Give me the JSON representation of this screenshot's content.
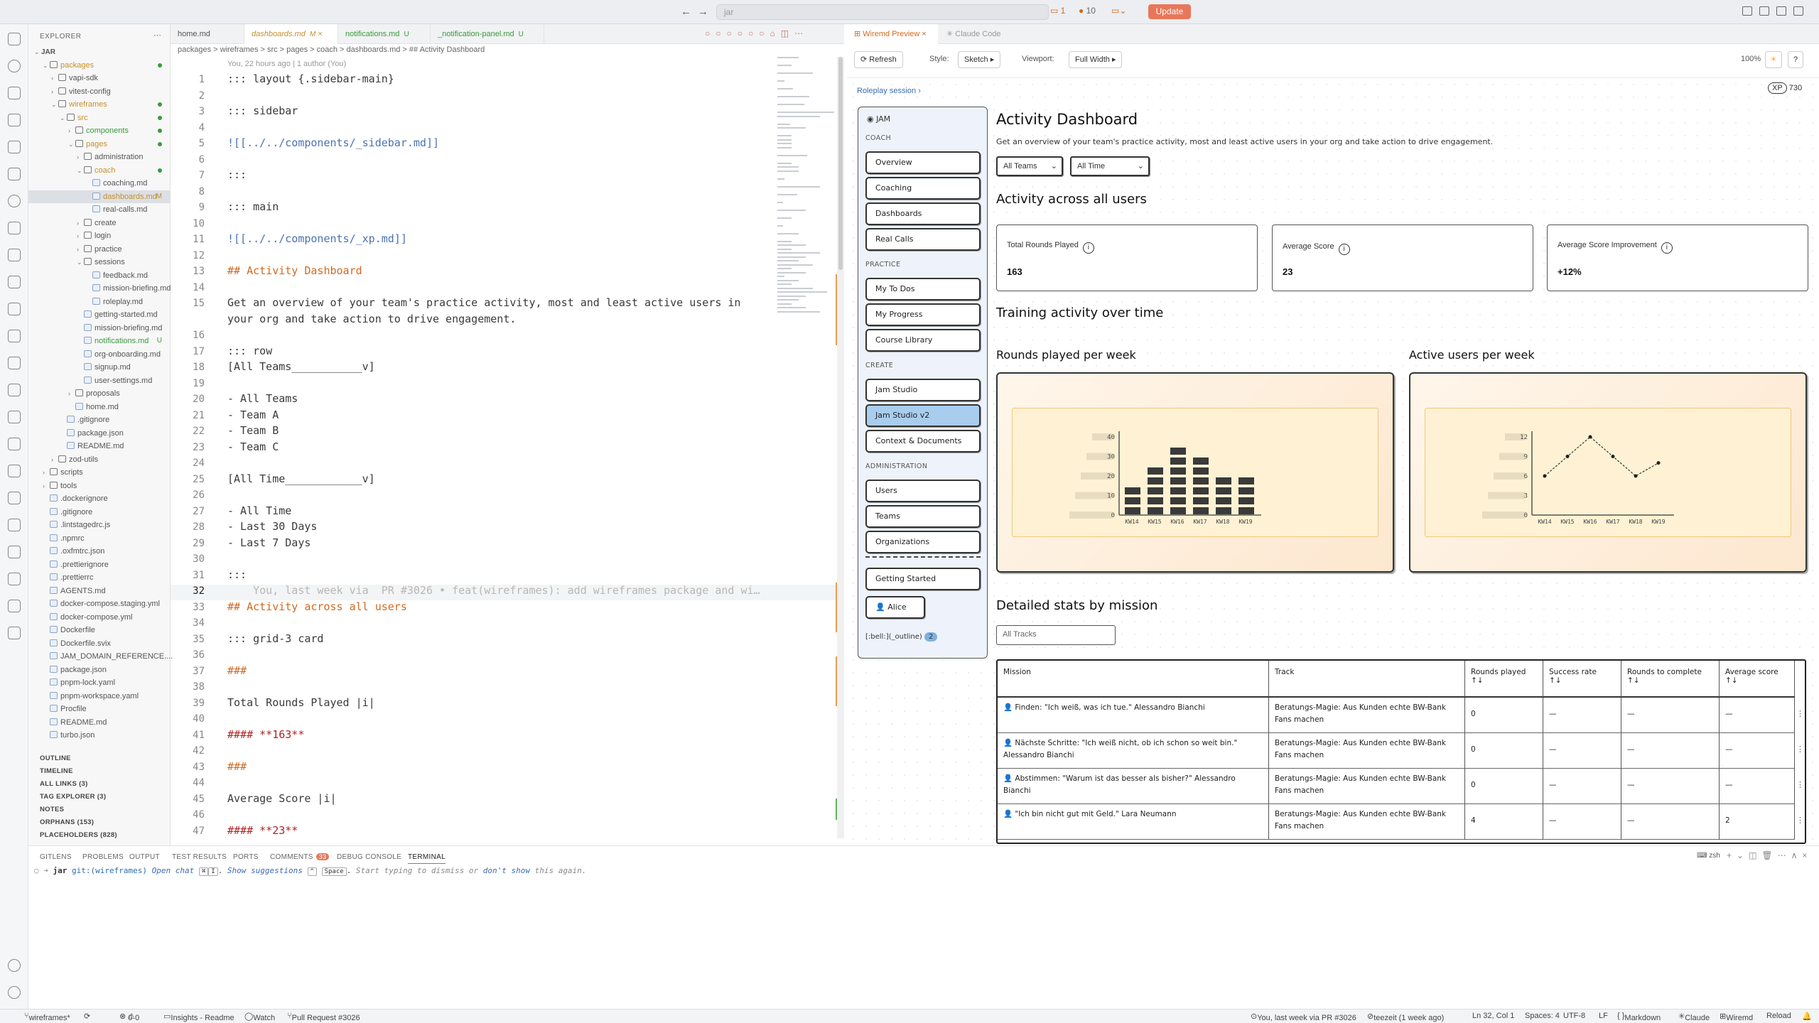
{
  "titlebar": {
    "search": "jar",
    "badge_comments": "1",
    "badge_errors": "10",
    "update": "Update"
  },
  "explorer": {
    "title": "EXPLORER",
    "rows": [
      {
        "t": "JAR",
        "d": 0,
        "f": "root",
        "c": "folder"
      },
      {
        "t": "packages",
        "d": 1,
        "f": "open",
        "c": "mod",
        "g": "dot"
      },
      {
        "t": "vapi-sdk",
        "d": 2,
        "f": "closed",
        "c": "folder"
      },
      {
        "t": "vitest-config",
        "d": 2,
        "f": "closed",
        "c": "folder"
      },
      {
        "t": "wireframes",
        "d": 2,
        "f": "open",
        "c": "mod",
        "g": "dot"
      },
      {
        "t": "src",
        "d": 3,
        "f": "open",
        "c": "mod",
        "g": "dot"
      },
      {
        "t": "components",
        "d": 4,
        "f": "closed",
        "c": "untr",
        "g": "dot"
      },
      {
        "t": "pages",
        "d": 4,
        "f": "open",
        "c": "mod",
        "g": "dot"
      },
      {
        "t": "administration",
        "d": 5,
        "f": "closed",
        "c": "folder"
      },
      {
        "t": "coach",
        "d": 5,
        "f": "open",
        "c": "mod",
        "g": "dot"
      },
      {
        "t": "coaching.md",
        "d": 6,
        "f": "file",
        "c": "folder"
      },
      {
        "t": "dashboards.md",
        "d": 6,
        "f": "file",
        "c": "mod",
        "g": "M",
        "sel": true
      },
      {
        "t": "real-calls.md",
        "d": 6,
        "f": "file",
        "c": "folder"
      },
      {
        "t": "create",
        "d": 5,
        "f": "closed",
        "c": "folder"
      },
      {
        "t": "login",
        "d": 5,
        "f": "closed",
        "c": "folder"
      },
      {
        "t": "practice",
        "d": 5,
        "f": "closed",
        "c": "folder"
      },
      {
        "t": "sessions",
        "d": 5,
        "f": "open",
        "c": "folder"
      },
      {
        "t": "feedback.md",
        "d": 6,
        "f": "file",
        "c": "folder"
      },
      {
        "t": "mission-briefing.md",
        "d": 6,
        "f": "file",
        "c": "folder"
      },
      {
        "t": "roleplay.md",
        "d": 6,
        "f": "file",
        "c": "folder"
      },
      {
        "t": "getting-started.md",
        "d": 5,
        "f": "file",
        "c": "folder"
      },
      {
        "t": "mission-briefing.md",
        "d": 5,
        "f": "file",
        "c": "folder"
      },
      {
        "t": "notifications.md",
        "d": 5,
        "f": "file",
        "c": "untr",
        "g": "U"
      },
      {
        "t": "org-onboarding.md",
        "d": 5,
        "f": "file",
        "c": "folder"
      },
      {
        "t": "signup.md",
        "d": 5,
        "f": "file",
        "c": "folder"
      },
      {
        "t": "user-settings.md",
        "d": 5,
        "f": "file",
        "c": "folder"
      },
      {
        "t": "proposals",
        "d": 4,
        "f": "closed",
        "c": "folder"
      },
      {
        "t": "home.md",
        "d": 4,
        "f": "file",
        "c": "folder"
      },
      {
        "t": ".gitignore",
        "d": 3,
        "f": "file",
        "c": "folder"
      },
      {
        "t": "package.json",
        "d": 3,
        "f": "file",
        "c": "folder"
      },
      {
        "t": "README.md",
        "d": 3,
        "f": "file",
        "c": "folder"
      },
      {
        "t": "zod-utils",
        "d": 2,
        "f": "closed",
        "c": "folder"
      },
      {
        "t": "scripts",
        "d": 1,
        "f": "closed",
        "c": "folder"
      },
      {
        "t": "tools",
        "d": 1,
        "f": "closed",
        "c": "folder"
      },
      {
        "t": ".dockerignore",
        "d": 1,
        "f": "file",
        "c": "folder"
      },
      {
        "t": ".gitignore",
        "d": 1,
        "f": "file",
        "c": "folder"
      },
      {
        "t": ".lintstagedrc.js",
        "d": 1,
        "f": "file",
        "c": "folder"
      },
      {
        "t": ".npmrc",
        "d": 1,
        "f": "file",
        "c": "folder"
      },
      {
        "t": ".oxfmtrc.json",
        "d": 1,
        "f": "file",
        "c": "folder"
      },
      {
        "t": ".prettierignore",
        "d": 1,
        "f": "file",
        "c": "folder"
      },
      {
        "t": ".prettierrc",
        "d": 1,
        "f": "file",
        "c": "folder"
      },
      {
        "t": "AGENTS.md",
        "d": 1,
        "f": "file",
        "c": "folder"
      },
      {
        "t": "docker-compose.staging.yml",
        "d": 1,
        "f": "file",
        "c": "folder"
      },
      {
        "t": "docker-compose.yml",
        "d": 1,
        "f": "file",
        "c": "folder"
      },
      {
        "t": "Dockerfile",
        "d": 1,
        "f": "file",
        "c": "folder"
      },
      {
        "t": "Dockerfile.svix",
        "d": 1,
        "f": "file",
        "c": "folder"
      },
      {
        "t": "JAM_DOMAIN_REFERENCE....",
        "d": 1,
        "f": "file",
        "c": "folder"
      },
      {
        "t": "package.json",
        "d": 1,
        "f": "file",
        "c": "folder"
      },
      {
        "t": "pnpm-lock.yaml",
        "d": 1,
        "f": "file",
        "c": "folder"
      },
      {
        "t": "pnpm-workspace.yaml",
        "d": 1,
        "f": "file",
        "c": "folder"
      },
      {
        "t": "Procfile",
        "d": 1,
        "f": "file",
        "c": "folder"
      },
      {
        "t": "README.md",
        "d": 1,
        "f": "file",
        "c": "folder"
      },
      {
        "t": "turbo.json",
        "d": 1,
        "f": "file",
        "c": "folder"
      }
    ],
    "sections": [
      "OUTLINE",
      "TIMELINE",
      "ALL LINKS (3)",
      "TAG EXPLORER (3)",
      "NOTES",
      "ORPHANS (153)",
      "PLACEHOLDERS (828)"
    ]
  },
  "editor": {
    "tabs": [
      {
        "label": "home.md",
        "status": ""
      },
      {
        "label": "dashboards.md",
        "status": "M"
      },
      {
        "label": "notifications.md",
        "status": "U"
      },
      {
        "label": "_notification-panel.md",
        "status": "U"
      }
    ],
    "breadcrumb": "packages > wireframes > src > pages > coach > dashboards.md > ## Activity Dashboard",
    "blame": "You, 22 hours ago | 1 author (You)",
    "lines": [
      {
        "n": "1",
        "t": "::: layout {.sidebar-main}"
      },
      {
        "n": "2",
        "t": ""
      },
      {
        "n": "3",
        "t": "::: sidebar"
      },
      {
        "n": "4",
        "t": ""
      },
      {
        "n": "5",
        "t": "![[../../components/_sidebar.md]]",
        "k": "lk"
      },
      {
        "n": "6",
        "t": ""
      },
      {
        "n": "7",
        "t": ":::"
      },
      {
        "n": "8",
        "t": ""
      },
      {
        "n": "9",
        "t": "::: main"
      },
      {
        "n": "10",
        "t": ""
      },
      {
        "n": "11",
        "t": "![[../../components/_xp.md]]",
        "k": "lk"
      },
      {
        "n": "12",
        "t": ""
      },
      {
        "n": "13",
        "t": "## Activity Dashboard",
        "k": "h"
      },
      {
        "n": "14",
        "t": ""
      },
      {
        "n": "15",
        "t": "Get an overview of your team's practice activity, most and least active users in"
      },
      {
        "n": "",
        "t": "your org and take action to drive engagement."
      },
      {
        "n": "16",
        "t": ""
      },
      {
        "n": "17",
        "t": "::: row"
      },
      {
        "n": "18",
        "t": "[All Teams___________v]"
      },
      {
        "n": "19",
        "t": ""
      },
      {
        "n": "20",
        "t": "- All Teams"
      },
      {
        "n": "21",
        "t": "- Team A"
      },
      {
        "n": "22",
        "t": "- Team B"
      },
      {
        "n": "23",
        "t": "- Team C"
      },
      {
        "n": "24",
        "t": ""
      },
      {
        "n": "25",
        "t": "[All Time____________v]"
      },
      {
        "n": "26",
        "t": ""
      },
      {
        "n": "27",
        "t": "- All Time"
      },
      {
        "n": "28",
        "t": "- Last 30 Days"
      },
      {
        "n": "29",
        "t": "- Last 7 Days"
      },
      {
        "n": "30",
        "t": ""
      },
      {
        "n": "31",
        "t": ":::"
      },
      {
        "n": "32",
        "t": "    You, last week via  PR #3026 • feat(wireframes): add wireframes package and wi…",
        "k": "ghost"
      },
      {
        "n": "33",
        "t": "## Activity across all users",
        "k": "h"
      },
      {
        "n": "34",
        "t": ""
      },
      {
        "n": "35",
        "t": "::: grid-3 card"
      },
      {
        "n": "36",
        "t": ""
      },
      {
        "n": "37",
        "t": "###",
        "k": "h"
      },
      {
        "n": "38",
        "t": ""
      },
      {
        "n": "39",
        "t": "Total Rounds Played |i|"
      },
      {
        "n": "40",
        "t": ""
      },
      {
        "n": "41",
        "t": "#### **163**",
        "k": "hb"
      },
      {
        "n": "42",
        "t": ""
      },
      {
        "n": "43",
        "t": "###",
        "k": "h"
      },
      {
        "n": "44",
        "t": ""
      },
      {
        "n": "45",
        "t": "Average Score |i|"
      },
      {
        "n": "46",
        "t": ""
      },
      {
        "n": "47",
        "t": "#### **23**",
        "k": "hb"
      }
    ]
  },
  "preview": {
    "tabs": [
      "Wiremd Preview",
      "Claude Code"
    ],
    "refresh": "Refresh",
    "style_label": "Style:",
    "style_value": "Sketch",
    "viewport_label": "Viewport:",
    "viewport_value": "Full Width",
    "zoom": "100%",
    "help": "?",
    "roleplay_link": "Roleplay session ›",
    "xp_label": "XP",
    "xp_value": "730",
    "sidebar": {
      "brand": "JAM",
      "sections": [
        {
          "title": "COACH",
          "items": [
            "Overview",
            "Coaching",
            "Dashboards",
            "Real Calls"
          ]
        },
        {
          "title": "PRACTICE",
          "items": [
            "My To Dos",
            "My Progress",
            "Course Library"
          ]
        },
        {
          "title": "CREATE",
          "items": [
            "Jam Studio",
            "Jam Studio v2",
            "Context & Documents"
          ]
        },
        {
          "title": "ADMINISTRATION",
          "items": [
            "Users",
            "Teams",
            "Organizations"
          ]
        }
      ],
      "active": "Jam Studio v2",
      "getting_started": "Getting Started",
      "user": "Alice",
      "bell_text": "[:bell:](_outline)",
      "bell_count": "2"
    },
    "main": {
      "title": "Activity Dashboard",
      "desc": "Get an overview of your team's practice activity, most and least active users in your org and take action to drive engagement.",
      "team_select": "All Teams",
      "time_select": "All Time",
      "section1": "Activity across all users",
      "cards": [
        {
          "label": "Total Rounds Played",
          "value": "163"
        },
        {
          "label": "Average Score",
          "value": "23"
        },
        {
          "label": "Average Score Improvement",
          "value": "+12%"
        }
      ],
      "section2": "Training activity over time",
      "chart1_title": "Rounds played per week",
      "chart2_title": "Active users per week",
      "section3": "Detailed stats by mission",
      "filter": "All Tracks",
      "table": {
        "headers": [
          "Mission",
          "Track",
          "Rounds played\n↑↓",
          "Success rate\n↑↓",
          "Rounds to complete\n↑↓",
          "Average score\n↑↓"
        ],
        "rows": [
          [
            "👤 Finden: \"Ich weiß, was ich tue.\" Alessandro Bianchi",
            "Beratungs-Magie: Aus Kunden echte BW-Bank Fans machen",
            "0",
            "—",
            "—",
            "—"
          ],
          [
            "👤 Nächste Schritte: \"Ich weiß nicht, ob ich schon so weit bin.\" Alessandro Bianchi",
            "Beratungs-Magie: Aus Kunden echte BW-Bank Fans machen",
            "0",
            "—",
            "—",
            "—"
          ],
          [
            "👤 Abstimmen: \"Warum ist das besser als bisher?\" Alessandro Bianchi",
            "Beratungs-Magie: Aus Kunden echte BW-Bank Fans machen",
            "0",
            "—",
            "—",
            "—"
          ],
          [
            "👤 \"Ich bin nicht gut mit Geld.\" Lara Neumann",
            "Beratungs-Magie: Aus Kunden echte BW-Bank Fans machen",
            "4",
            "—",
            "—",
            "2"
          ]
        ]
      }
    }
  },
  "chart_data": [
    {
      "type": "bar",
      "title": "Rounds played per week",
      "categories": [
        "KW14",
        "KW15",
        "KW16",
        "KW17",
        "KW18",
        "KW19"
      ],
      "yticks": [
        "0",
        "10",
        "20",
        "30",
        "40"
      ],
      "values": [
        15,
        25,
        35,
        30,
        20,
        20
      ]
    },
    {
      "type": "line",
      "title": "Active users per week",
      "categories": [
        "KW14",
        "KW15",
        "KW16",
        "KW17",
        "KW18",
        "KW19"
      ],
      "yticks": [
        "0",
        "3",
        "6",
        "9",
        "12"
      ],
      "values": [
        6,
        9,
        12,
        9,
        6,
        8
      ]
    }
  ],
  "panel": {
    "tabs": [
      "GITLENS",
      "PROBLEMS",
      "OUTPUT",
      "TEST RESULTS",
      "PORTS",
      "COMMENTS",
      "DEBUG CONSOLE",
      "TERMINAL"
    ],
    "comments_count": "33",
    "shell": "zsh",
    "prompt_dir": "jar",
    "prompt_branch": "git:(wireframes)",
    "hint_open": "Open chat",
    "hint_key1": "⌘",
    "hint_key2": "I",
    "hint_suggest": "Show suggestions",
    "hint_key3": "^",
    "hint_key4": "Space",
    "hint_dismiss": "Start typing to dismiss or",
    "hint_dontshow": "don't show",
    "hint_again": "this again."
  },
  "statusbar": {
    "branch": "wireframes*",
    "errors": "0",
    "warnings": "0",
    "insights": "Insights - Readme",
    "watch": "Watch",
    "pr": "Pull Request #3026",
    "blame": "You, last week via PR #3026",
    "author": "teezeit (1 week ago)",
    "position": "Ln 32, Col 1",
    "spaces": "Spaces: 4",
    "encoding": "UTF-8",
    "eol": "LF",
    "language": "Markdown",
    "claude": "Claude",
    "wiremd": "Wiremd",
    "reload": "Reload"
  },
  "colors": {
    "accent": "#d2691e",
    "update": "#e8775a",
    "active_nav": "#a9cdee",
    "chart_bg": "#fff2d4"
  }
}
